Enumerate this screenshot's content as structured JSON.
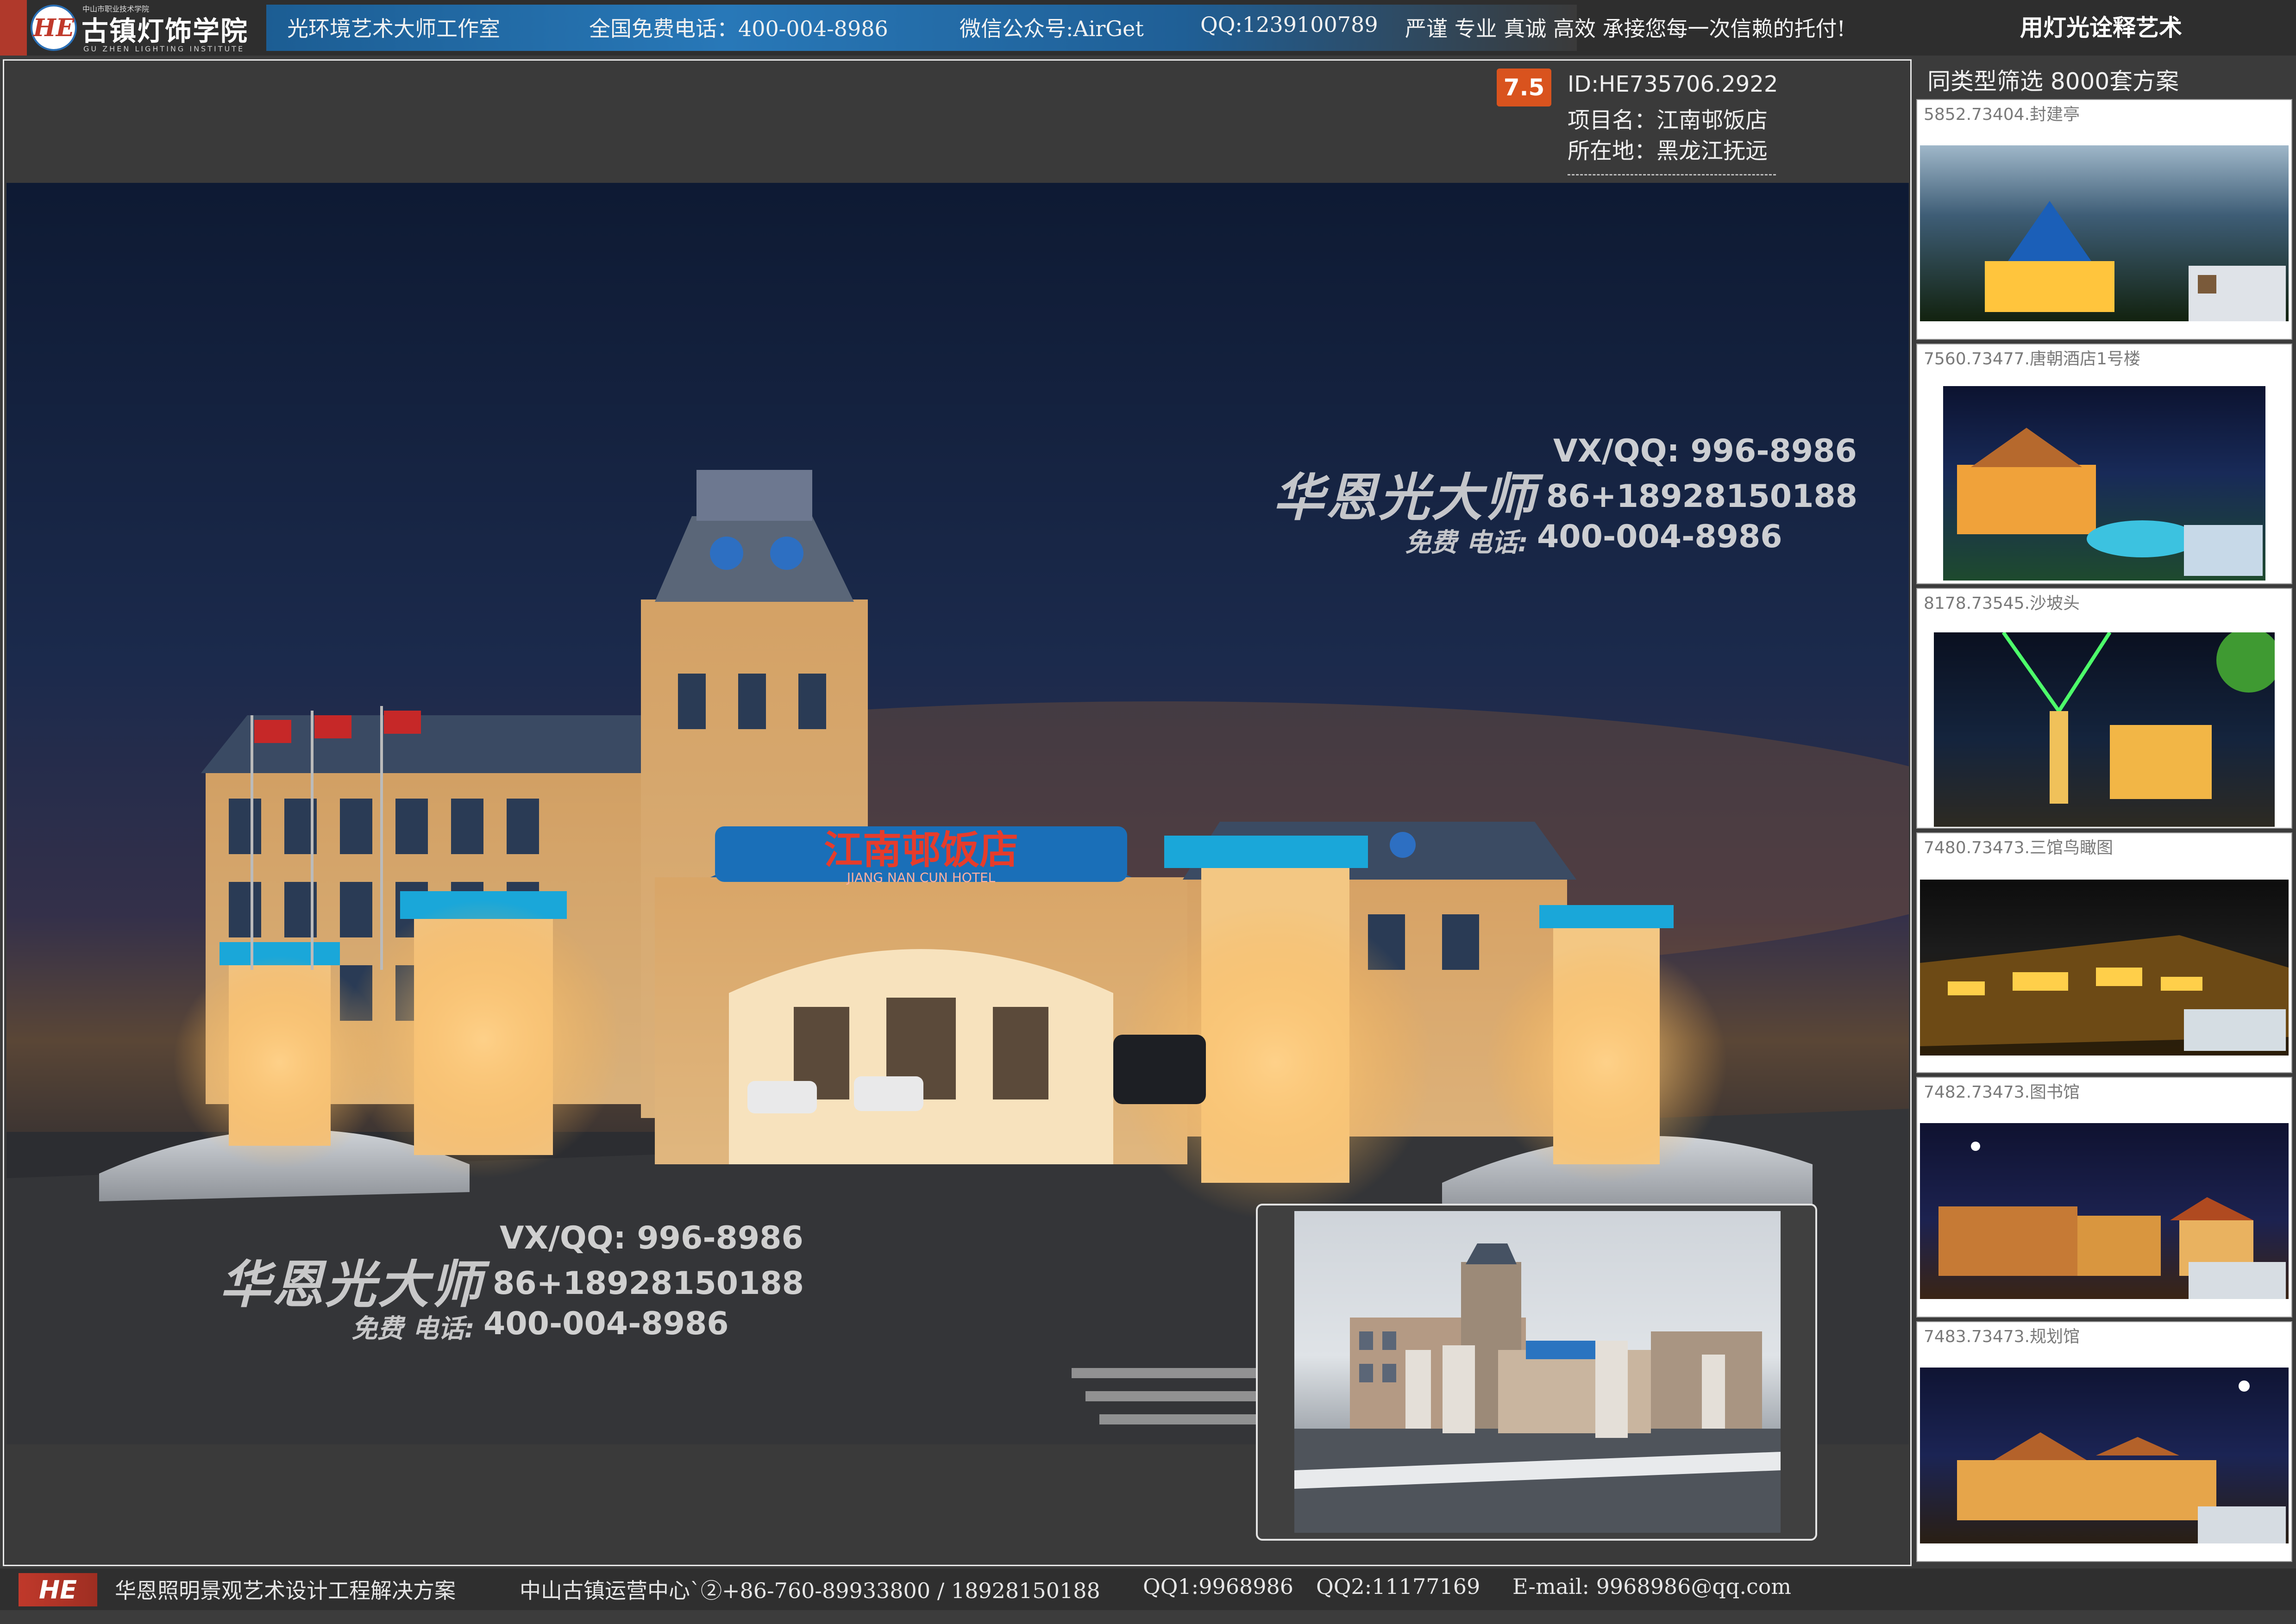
{
  "header": {
    "logo_mark": "HE",
    "school_small": "中山市职业技术学院",
    "school_name": "古镇灯饰学院",
    "school_en": "GU ZHEN LIGHTING INSTITUTE",
    "studio": "光环境艺术大师工作室",
    "hotline": "全国免费电话：400-004-8986",
    "wechat": "微信公众号:AirGet",
    "qq": "QQ:1239100789",
    "slogan": "严谨 专业 真诚 高效 承接您每一次信赖的托付!",
    "right_title": "用灯光诠释艺术"
  },
  "project": {
    "score": "7.5",
    "id": "ID:HE735706.2922",
    "name": "项目名：江南邨饭店",
    "location": "所在地：黑龙江抚远"
  },
  "watermark": {
    "brand": "华恩光大师",
    "vx": "VX/QQ: 996-8986",
    "phone": "86+18928150188",
    "free_label": "免费 电话:",
    "hotline": "400-004-8986"
  },
  "hotel_sign": {
    "cn": "江南邨饭店",
    "en": "JIANG NAN CUN HOTEL"
  },
  "sidebar": {
    "heading": "同类型筛选 8000套方案",
    "items": [
      {
        "caption": "5852.73404.封建亭",
        "icon": "pavilion-night-thumbnail"
      },
      {
        "caption": "7560.73477.唐朝酒店1号楼",
        "icon": "hotel-night-thumbnail"
      },
      {
        "caption": "8178.73545.沙坡头",
        "icon": "street-laser-thumbnail"
      },
      {
        "caption": "7480.73473.三馆鸟瞰图",
        "icon": "aerial-night-thumbnail"
      },
      {
        "caption": "7482.73473.图书馆",
        "icon": "library-night-thumbnail"
      },
      {
        "caption": "7483.73473.规划馆",
        "icon": "planning-hall-thumbnail"
      }
    ]
  },
  "footer": {
    "logo": "HE",
    "solution": "华恩照明景观艺术设计工程解决方案",
    "center": "中山古镇运营中心`②+86-760-89933800 / 18928150188",
    "qq1": "QQ1:9968986",
    "qq2": "QQ2:11177169",
    "email": "E-mail: 9968986@qq.com"
  },
  "colors": {
    "accent_red": "#c0392b",
    "header_blue": "#2878b8",
    "score_orange": "#d9531e",
    "background": "#3a3a3a"
  }
}
